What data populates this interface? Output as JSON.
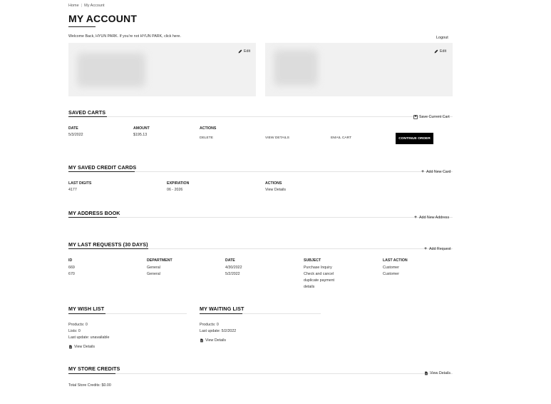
{
  "breadcrumb": {
    "home": "Home",
    "separator": "|",
    "current": "My Account"
  },
  "page_title": "MY ACCOUNT",
  "welcome": {
    "prefix": "Welcome Back, HYUN PARK. If you're not HYUN PARK,",
    "link": "click here."
  },
  "logout_label": "Logout",
  "profile_cards": {
    "edit_label": "Edit"
  },
  "saved_carts": {
    "title": "SAVED CARTS",
    "save_current_label": "Save Current Cart",
    "columns": {
      "date": "DATE",
      "amount": "AMOUNT",
      "actions": "ACTIONS"
    },
    "rows": [
      {
        "date": "5/3/2022",
        "amount": "$195.13",
        "delete": "DELETE",
        "view": "VIEW DETAILS",
        "email": "EMAIL CART",
        "continue": "CONTINUE ORDER"
      }
    ]
  },
  "credit_cards": {
    "title": "MY SAVED CREDIT CARDS",
    "add_label": "Add New Card",
    "columns": {
      "last_digits": "LAST DIGITS",
      "expiration": "EXPIRATION",
      "actions": "ACTIONS"
    },
    "rows": [
      {
        "last_digits": "4177",
        "expiration": "06 - 2026",
        "action": "View Details"
      }
    ]
  },
  "address_book": {
    "title": "MY ADDRESS BOOK",
    "add_label": "Add New Address"
  },
  "requests": {
    "title": "MY LAST REQUESTS (30 DAYS)",
    "add_label": "Add Request",
    "columns": {
      "id": "ID",
      "department": "DEPARTMENT",
      "date": "DATE",
      "subject": "SUBJECT",
      "last_action": "LAST ACTION"
    },
    "rows": [
      {
        "id": "669",
        "department": "General",
        "date": "4/30/2022",
        "subject": "Purchase Inquiry",
        "last_action": "Customer"
      },
      {
        "id": "670",
        "department": "General",
        "date": "5/2/2022",
        "subject_lines": [
          "Check and cancel",
          "duplicate payment",
          "details"
        ],
        "last_action": "Customer"
      }
    ]
  },
  "wish_list": {
    "title": "MY WISH LIST",
    "products": "Products: 0",
    "lists": "Lists: 0",
    "last_update": "Last update: unavailable",
    "view_label": "View Details"
  },
  "waiting_list": {
    "title": "MY WAITING LIST",
    "products": "Products: 0",
    "last_update": "Last update: 5/2/2022",
    "view_label": "View Details"
  },
  "store_credits": {
    "title": "MY STORE CREDITS",
    "view_label": "View Details",
    "total": "Total Store Credits: $0.00"
  },
  "icons": {
    "edit": "pencil-icon",
    "save": "floppy-icon",
    "add": "plus-icon",
    "document": "document-icon"
  }
}
